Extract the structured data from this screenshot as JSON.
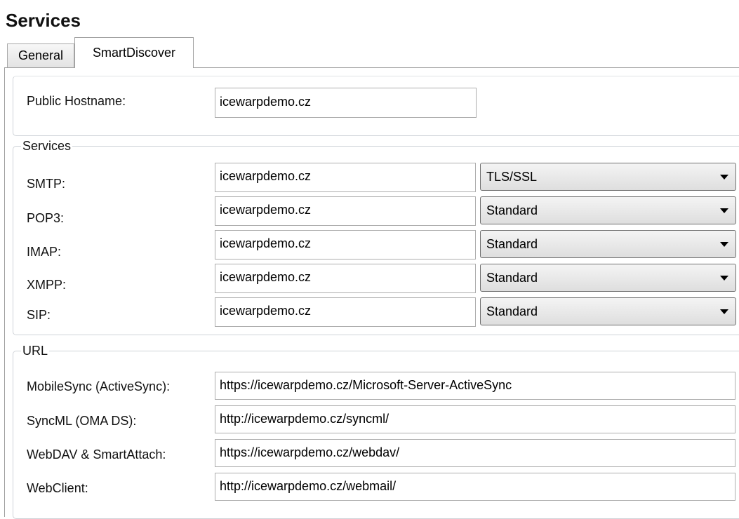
{
  "page": {
    "title": "Services"
  },
  "tabs": [
    {
      "label": "General"
    },
    {
      "label": "SmartDiscover"
    }
  ],
  "hostname": {
    "label": "Public Hostname:",
    "value": "icewarpdemo.cz"
  },
  "services": {
    "legend": "Services",
    "rows": [
      {
        "label": "SMTP:",
        "value": "icewarpdemo.cz",
        "mode": "TLS/SSL"
      },
      {
        "label": "POP3:",
        "value": "icewarpdemo.cz",
        "mode": "Standard"
      },
      {
        "label": "IMAP:",
        "value": "icewarpdemo.cz",
        "mode": "Standard"
      },
      {
        "label": "XMPP:",
        "value": "icewarpdemo.cz",
        "mode": "Standard"
      },
      {
        "label": "SIP:",
        "value": "icewarpdemo.cz",
        "mode": "Standard"
      }
    ]
  },
  "url": {
    "legend": "URL",
    "rows": [
      {
        "label": "MobileSync (ActiveSync):",
        "value": "https://icewarpdemo.cz/Microsoft-Server-ActiveSync"
      },
      {
        "label": "SyncML (OMA DS):",
        "value": "http://icewarpdemo.cz/syncml/"
      },
      {
        "label": "WebDAV & SmartAttach:",
        "value": "https://icewarpdemo.cz/webdav/"
      },
      {
        "label": "WebClient:",
        "value": "http://icewarpdemo.cz/webmail/"
      }
    ]
  }
}
